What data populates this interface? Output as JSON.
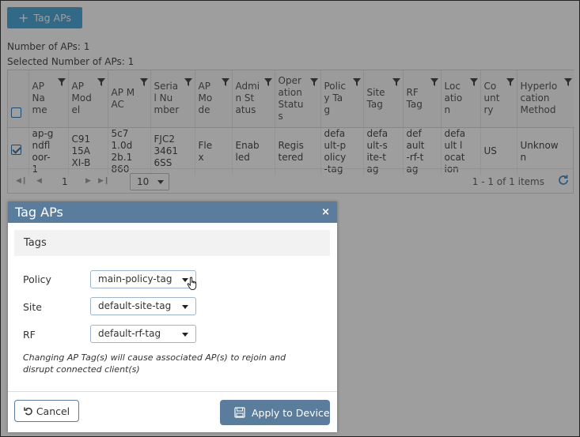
{
  "toolbar": {
    "tag_aps_label": "Tag APs"
  },
  "counts": {
    "number_of_aps": "Number of APs: 1",
    "selected_number_of_aps": "Selected Number of APs: 1"
  },
  "table": {
    "columns": [
      "AP Name",
      "AP Model",
      "AP MAC",
      "Serial Number",
      "AP Mode",
      "Admin Status",
      "Operation Status",
      "Policy Tag",
      "Site Tag",
      "RF Tag",
      "Location",
      "Country",
      "Hyperlocation Method"
    ],
    "rows": [
      {
        "selected": true,
        "cells": [
          "ap-gndfloor-1",
          "C9115AXI-B",
          "5c71.0d2b.1860",
          "FJC234616SS",
          "Flex",
          "Enabled",
          "Registered",
          "default-policy-tag",
          "default-site-tag",
          "default-rf-tag",
          "default location",
          "US",
          "Unknown"
        ]
      }
    ]
  },
  "pager": {
    "current_page": "1",
    "page_size": "10",
    "info": "1 - 1 of 1 items"
  },
  "modal": {
    "title": "Tag APs",
    "close_label": "×",
    "section_title": "Tags",
    "fields": [
      {
        "label": "Policy",
        "value": "main-policy-tag"
      },
      {
        "label": "Site",
        "value": "default-site-tag"
      },
      {
        "label": "RF",
        "value": "default-rf-tag"
      }
    ],
    "warning": "Changing AP Tag(s) will cause associated AP(s) to rejoin and disrupt connected client(s)",
    "cancel_label": "Cancel",
    "apply_label": "Apply to Device"
  },
  "colors": {
    "accent": "#3b9fd6",
    "modal_header": "#5a7d9e",
    "checkbox": "#1a67a6"
  }
}
